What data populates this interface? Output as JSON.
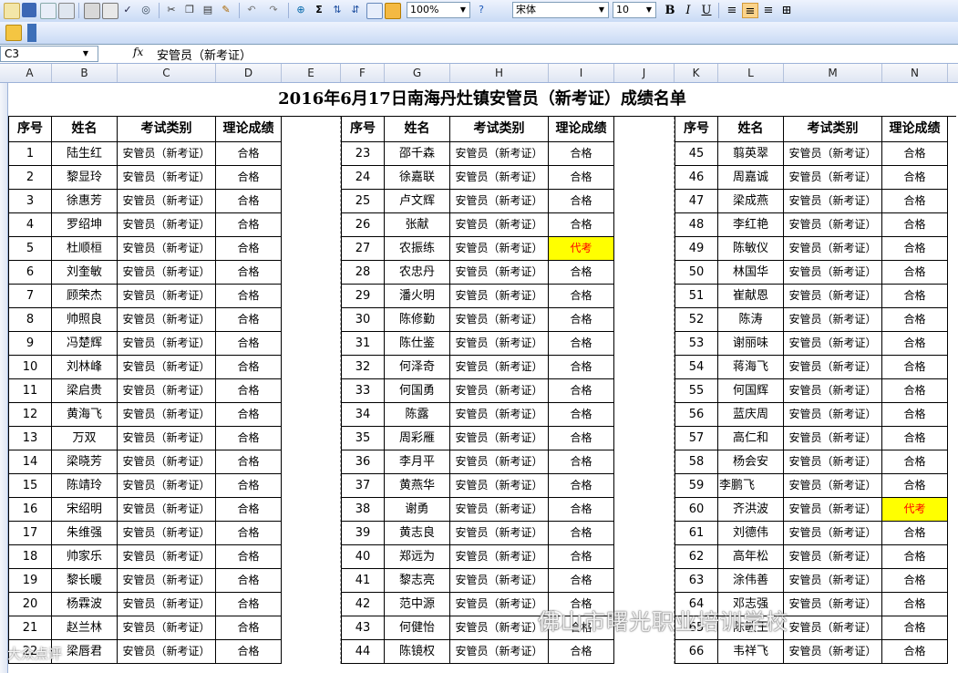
{
  "toolbar": {
    "zoom": "100%",
    "font_name": "宋体",
    "font_size": "10",
    "sum_glyph": "Σ",
    "bold": "B",
    "italic": "I",
    "underline": "U"
  },
  "formula_bar": {
    "name_box": "C3",
    "fx_label": "fx",
    "formula": "安管员（新考证）"
  },
  "columns": [
    "A",
    "B",
    "C",
    "D",
    "E",
    "F",
    "G",
    "H",
    "I",
    "J",
    "K",
    "L",
    "M",
    "N"
  ],
  "sheet": {
    "title": "2016年6月17日南海丹灶镇安管员（新考证）成绩名单",
    "headers": [
      "序号",
      "姓名",
      "考试类别",
      "理论成绩"
    ],
    "category": "安管员（新考证）",
    "pass": "合格",
    "absent": "代考",
    "groups": [
      {
        "rows": [
          {
            "no": "1",
            "name": "陆生红",
            "result": "合格"
          },
          {
            "no": "2",
            "name": "黎显玲",
            "result": "合格"
          },
          {
            "no": "3",
            "name": "徐惠芳",
            "result": "合格"
          },
          {
            "no": "4",
            "name": "罗绍坤",
            "result": "合格"
          },
          {
            "no": "5",
            "name": "杜顺桓",
            "result": "合格"
          },
          {
            "no": "6",
            "name": "刘奎敏",
            "result": "合格"
          },
          {
            "no": "7",
            "name": "顾荣杰",
            "result": "合格"
          },
          {
            "no": "8",
            "name": "帅照良",
            "result": "合格"
          },
          {
            "no": "9",
            "name": "冯楚辉",
            "result": "合格"
          },
          {
            "no": "10",
            "name": "刘林峰",
            "result": "合格"
          },
          {
            "no": "11",
            "name": "梁启贵",
            "result": "合格"
          },
          {
            "no": "12",
            "name": "黄海飞",
            "result": "合格"
          },
          {
            "no": "13",
            "name": "万双",
            "result": "合格"
          },
          {
            "no": "14",
            "name": "梁晓芳",
            "result": "合格"
          },
          {
            "no": "15",
            "name": "陈靖玲",
            "result": "合格"
          },
          {
            "no": "16",
            "name": "宋绍明",
            "result": "合格"
          },
          {
            "no": "17",
            "name": "朱维强",
            "result": "合格"
          },
          {
            "no": "18",
            "name": "帅家乐",
            "result": "合格"
          },
          {
            "no": "19",
            "name": "黎长暖",
            "result": "合格"
          },
          {
            "no": "20",
            "name": "杨霖波",
            "result": "合格"
          },
          {
            "no": "21",
            "name": "赵兰林",
            "result": "合格"
          },
          {
            "no": "22",
            "name": "梁唇君",
            "result": "合格"
          }
        ]
      },
      {
        "rows": [
          {
            "no": "23",
            "name": "邵千森",
            "result": "合格"
          },
          {
            "no": "24",
            "name": "徐嘉联",
            "result": "合格"
          },
          {
            "no": "25",
            "name": "卢文辉",
            "result": "合格"
          },
          {
            "no": "26",
            "name": "张献",
            "result": "合格"
          },
          {
            "no": "27",
            "name": "农振练",
            "result": "代考"
          },
          {
            "no": "28",
            "name": "农忠丹",
            "result": "合格"
          },
          {
            "no": "29",
            "name": "潘火明",
            "result": "合格"
          },
          {
            "no": "30",
            "name": "陈修勤",
            "result": "合格"
          },
          {
            "no": "31",
            "name": "陈仕鉴",
            "result": "合格"
          },
          {
            "no": "32",
            "name": "何泽奇",
            "result": "合格"
          },
          {
            "no": "33",
            "name": "何国勇",
            "result": "合格"
          },
          {
            "no": "34",
            "name": "陈露",
            "result": "合格"
          },
          {
            "no": "35",
            "name": "周彩雁",
            "result": "合格"
          },
          {
            "no": "36",
            "name": "李月平",
            "result": "合格"
          },
          {
            "no": "37",
            "name": "黄燕华",
            "result": "合格"
          },
          {
            "no": "38",
            "name": "谢勇",
            "result": "合格"
          },
          {
            "no": "39",
            "name": "黄志良",
            "result": "合格"
          },
          {
            "no": "40",
            "name": "郑远为",
            "result": "合格"
          },
          {
            "no": "41",
            "name": "黎志亮",
            "result": "合格"
          },
          {
            "no": "42",
            "name": "范中源",
            "result": "合格"
          },
          {
            "no": "43",
            "name": "何健怡",
            "result": "合格"
          },
          {
            "no": "44",
            "name": "陈镜权",
            "result": "合格"
          }
        ]
      },
      {
        "rows": [
          {
            "no": "45",
            "name": "翦英翠",
            "result": "合格"
          },
          {
            "no": "46",
            "name": "周嘉诚",
            "result": "合格"
          },
          {
            "no": "47",
            "name": "梁成燕",
            "result": "合格"
          },
          {
            "no": "48",
            "name": "李红艳",
            "result": "合格"
          },
          {
            "no": "49",
            "name": "陈敏仪",
            "result": "合格"
          },
          {
            "no": "50",
            "name": "林国华",
            "result": "合格"
          },
          {
            "no": "51",
            "name": "崔献恩",
            "result": "合格"
          },
          {
            "no": "52",
            "name": "陈涛",
            "result": "合格"
          },
          {
            "no": "53",
            "name": "谢丽味",
            "result": "合格"
          },
          {
            "no": "54",
            "name": "蒋海飞",
            "result": "合格"
          },
          {
            "no": "55",
            "name": "何国辉",
            "result": "合格"
          },
          {
            "no": "56",
            "name": "蓝庆周",
            "result": "合格"
          },
          {
            "no": "57",
            "name": "高仁和",
            "result": "合格"
          },
          {
            "no": "58",
            "name": "杨会安",
            "result": "合格"
          },
          {
            "no": "59",
            "name": "李鹏飞",
            "result": "合格"
          },
          {
            "no": "60",
            "name": "齐洪波",
            "result": "代考"
          },
          {
            "no": "61",
            "name": "刘德伟",
            "result": "合格"
          },
          {
            "no": "62",
            "name": "高年松",
            "result": "合格"
          },
          {
            "no": "63",
            "name": "涂伟善",
            "result": "合格"
          },
          {
            "no": "64",
            "name": "邓志强",
            "result": "合格"
          },
          {
            "no": "65",
            "name": "陈敏王",
            "result": "合格"
          },
          {
            "no": "66",
            "name": "韦祥飞",
            "result": "合格"
          }
        ]
      }
    ]
  },
  "watermark": "佛山市曙光职业培训学校",
  "corner_watermark": "大众点评"
}
